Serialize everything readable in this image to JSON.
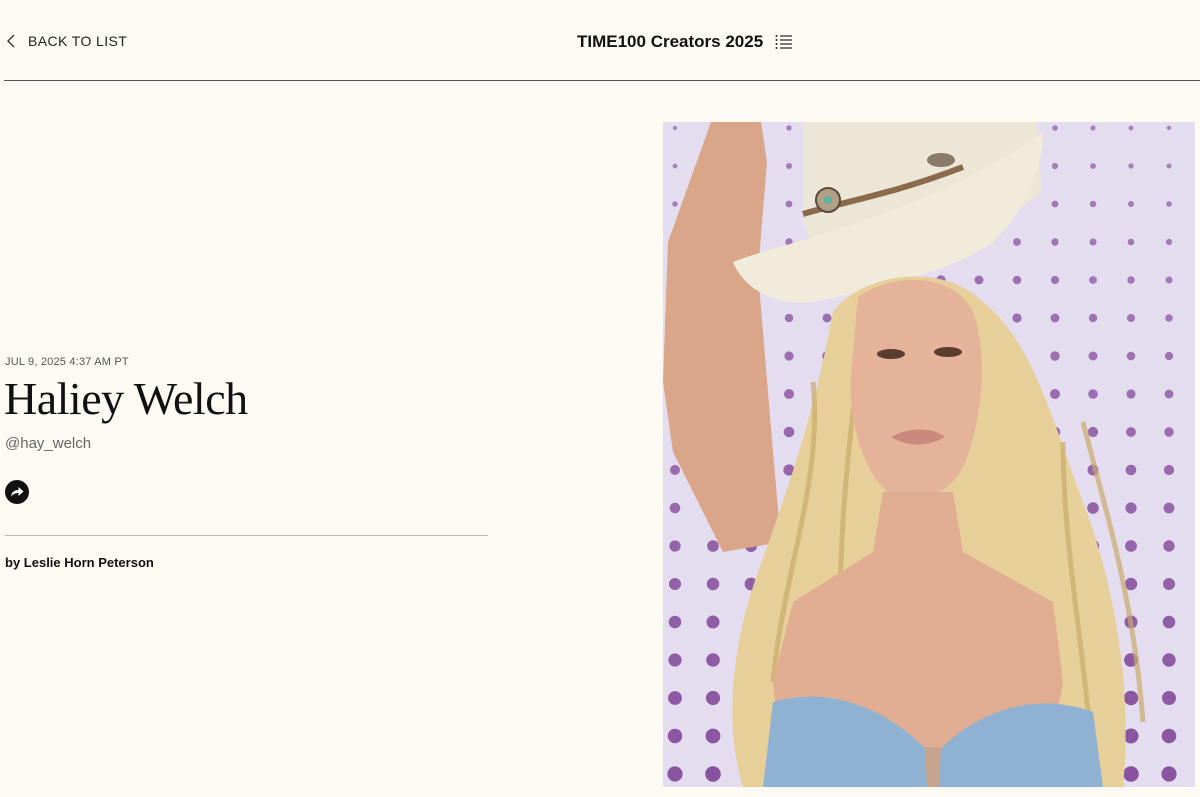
{
  "nav": {
    "back_label": "BACK TO LIST",
    "list_title": "TIME100 Creators 2025"
  },
  "article": {
    "date": "JUL 9, 2025 4:37 AM PT",
    "name": "Haliey Welch",
    "handle": "@hay_welch",
    "by_prefix": "by",
    "author": "Leslie Horn Peterson"
  },
  "icons": {
    "back": "chevron-left-icon",
    "menu": "list-menu-icon",
    "share": "share-arrow-icon"
  },
  "colors": {
    "background": "#fdfaf4",
    "text": "#111111",
    "photo_background": "#e4dcef",
    "dots": "#7b3f94"
  }
}
